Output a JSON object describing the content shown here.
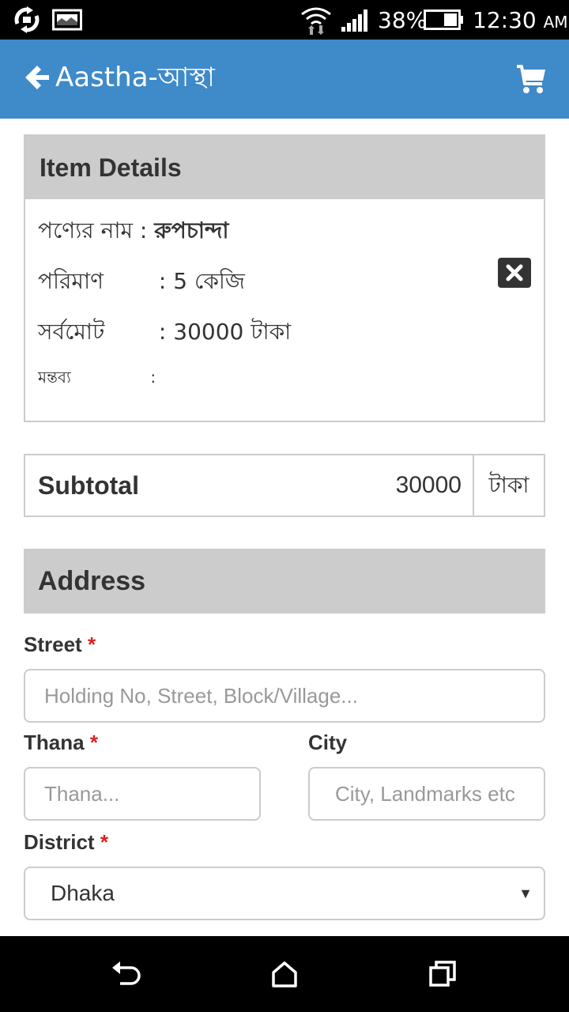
{
  "status_bar": {
    "battery": "38%",
    "time": "12:30",
    "time_suffix": "AM",
    "icons": [
      "sync-icon",
      "image-icon",
      "wifi-icon",
      "signal-icon",
      "battery-icon"
    ]
  },
  "app_bar": {
    "title": "Aastha-আস্থা",
    "back_icon": "arrow-left-icon",
    "cart_icon": "cart-icon",
    "color": "#3f8ac9"
  },
  "item_details": {
    "heading": "Item Details",
    "product_label": "পণ্যের নাম",
    "product_value": "রুপচান্দা",
    "quantity_label": "পরিমাণ",
    "quantity_value": "5 কেজি",
    "total_label": "সর্বমোট",
    "total_value": "30000 টাকা",
    "comment_label": "মন্তব্য",
    "comment_value": "",
    "colon": ":",
    "remove_icon": "close-icon"
  },
  "subtotal": {
    "label": "Subtotal",
    "value": "30000",
    "unit": "টাকা"
  },
  "address": {
    "heading": "Address",
    "street_label": "Street",
    "street_placeholder": "Holding No, Street, Block/Village...",
    "thana_label": "Thana",
    "thana_placeholder": "Thana...",
    "city_label": "City",
    "city_placeholder": "City, Landmarks etc",
    "district_label": "District",
    "district_value": "Dhaka",
    "required_mark": "*"
  },
  "nav_bar": {
    "icons": [
      "back-nav-icon",
      "home-nav-icon",
      "recents-nav-icon"
    ]
  }
}
